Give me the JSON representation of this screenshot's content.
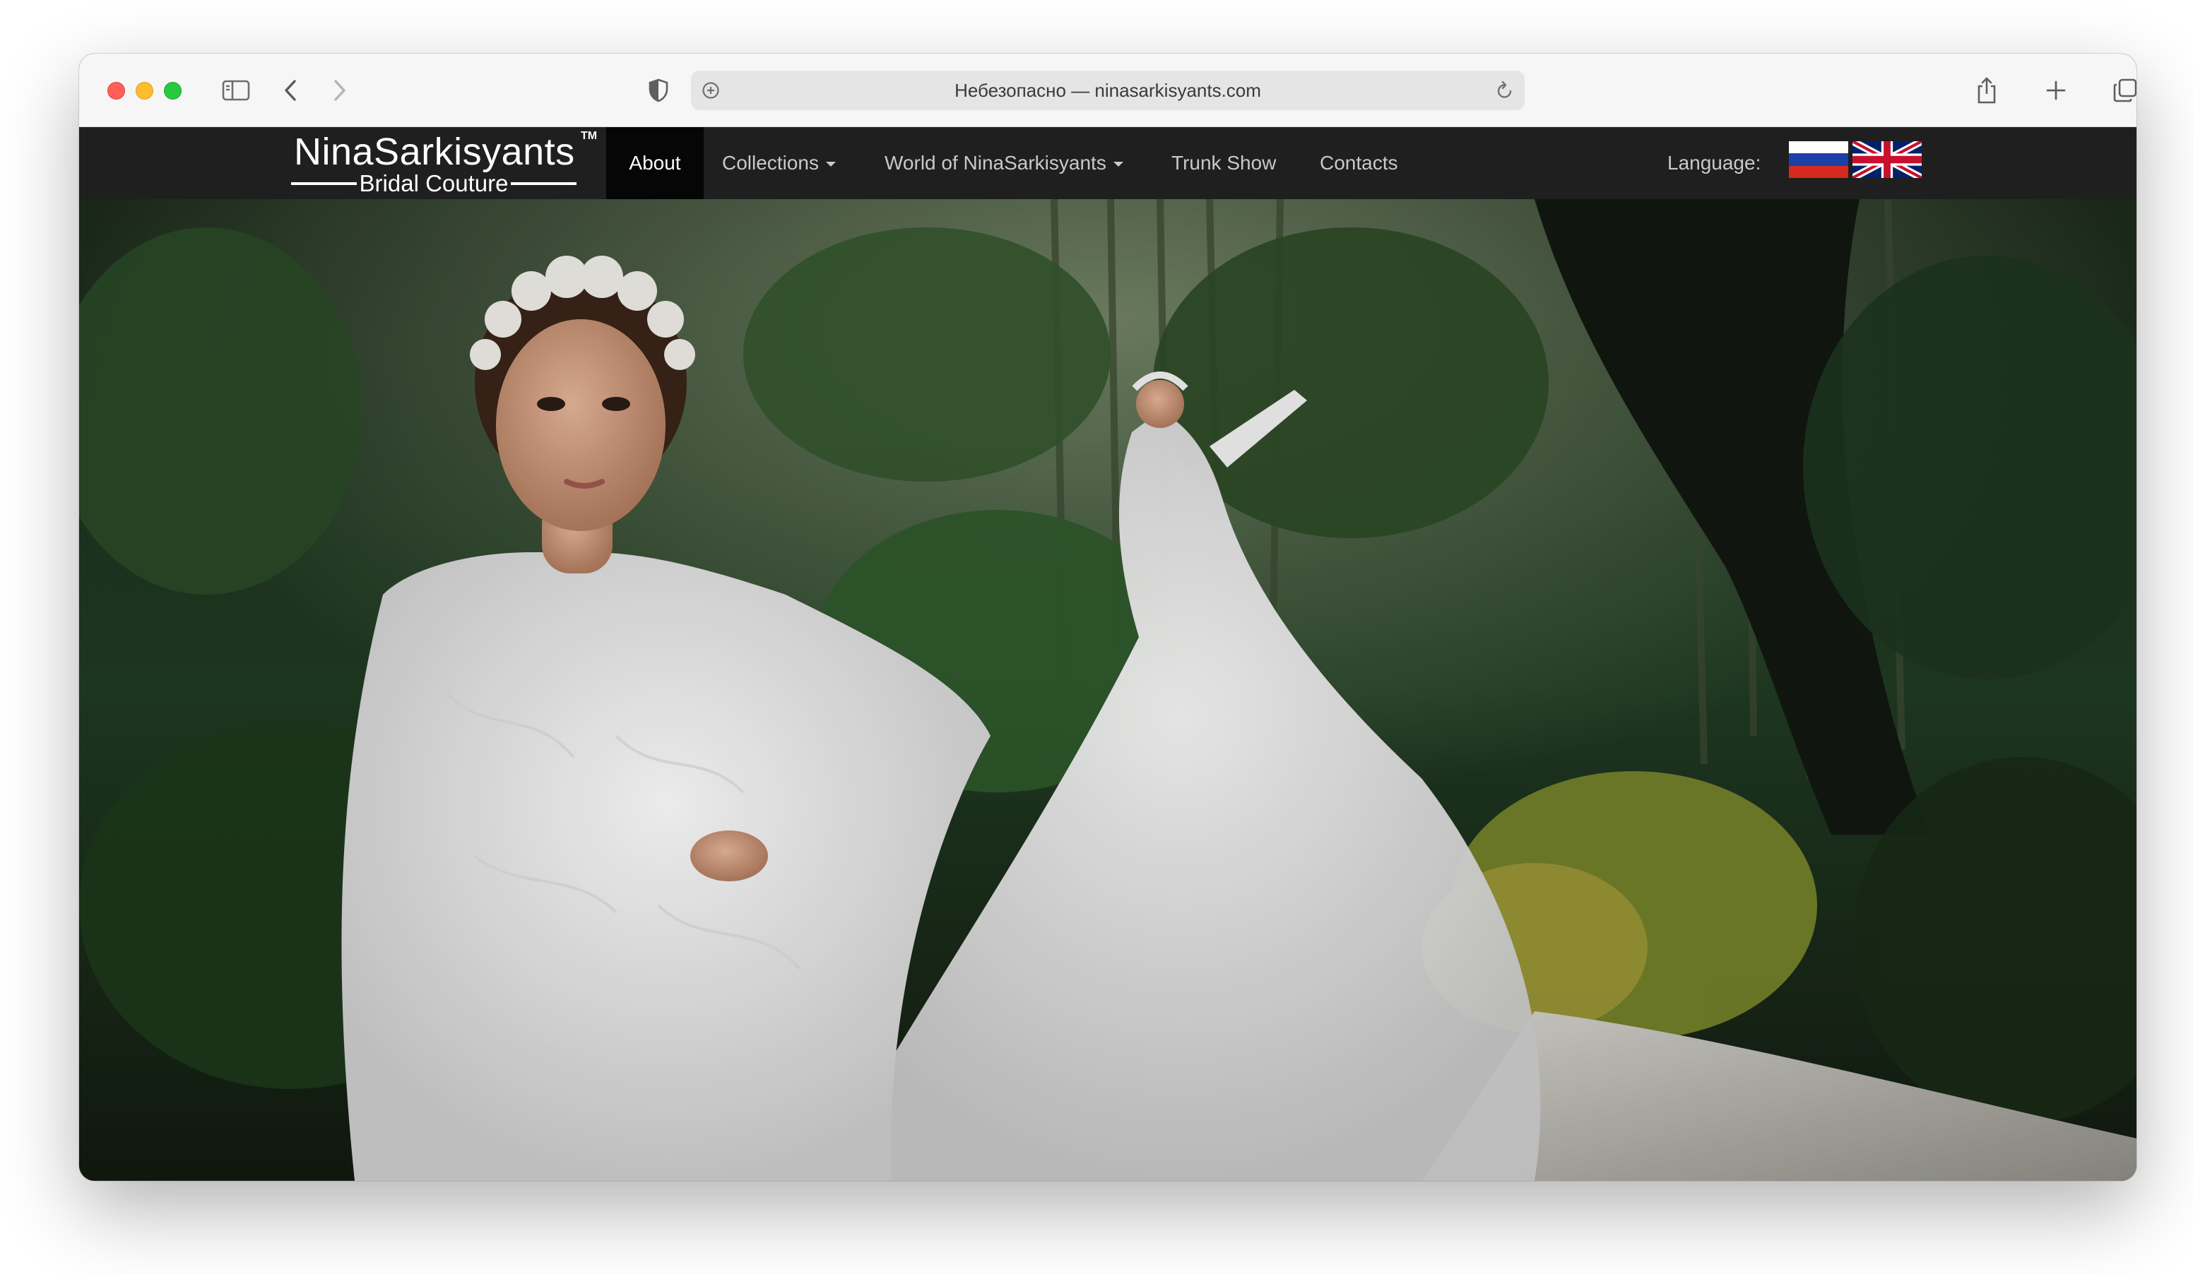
{
  "browser": {
    "address_bar": {
      "url_text": "Небезопасно — ninasarkisyants.com"
    },
    "icons": {
      "sidebar": "sidebar-icon",
      "back": "chevron-left-icon",
      "forward": "chevron-right-icon",
      "privacy": "shield-icon",
      "site_info": "site-info-icon",
      "reload": "reload-icon",
      "share": "share-icon",
      "new_tab": "plus-icon",
      "tab_overview": "tabs-icon"
    }
  },
  "site": {
    "logo": {
      "name": "NinaSarkisyants",
      "tm": "TM",
      "subtitle": "Bridal Couture"
    },
    "nav": {
      "items": [
        {
          "label": "About",
          "active": true,
          "dropdown": false
        },
        {
          "label": "Collections",
          "active": false,
          "dropdown": true
        },
        {
          "label": "World of NinaSarkisyants",
          "active": false,
          "dropdown": true
        },
        {
          "label": "Trunk Show",
          "active": false,
          "dropdown": false
        },
        {
          "label": "Contacts",
          "active": false,
          "dropdown": false
        }
      ],
      "language_label": "Language:",
      "languages": [
        "ru-flag",
        "uk-flag"
      ]
    },
    "colors": {
      "nav_background": "#1f1f1f",
      "nav_active": "#060606",
      "nav_text": "#c9c9c9"
    }
  }
}
